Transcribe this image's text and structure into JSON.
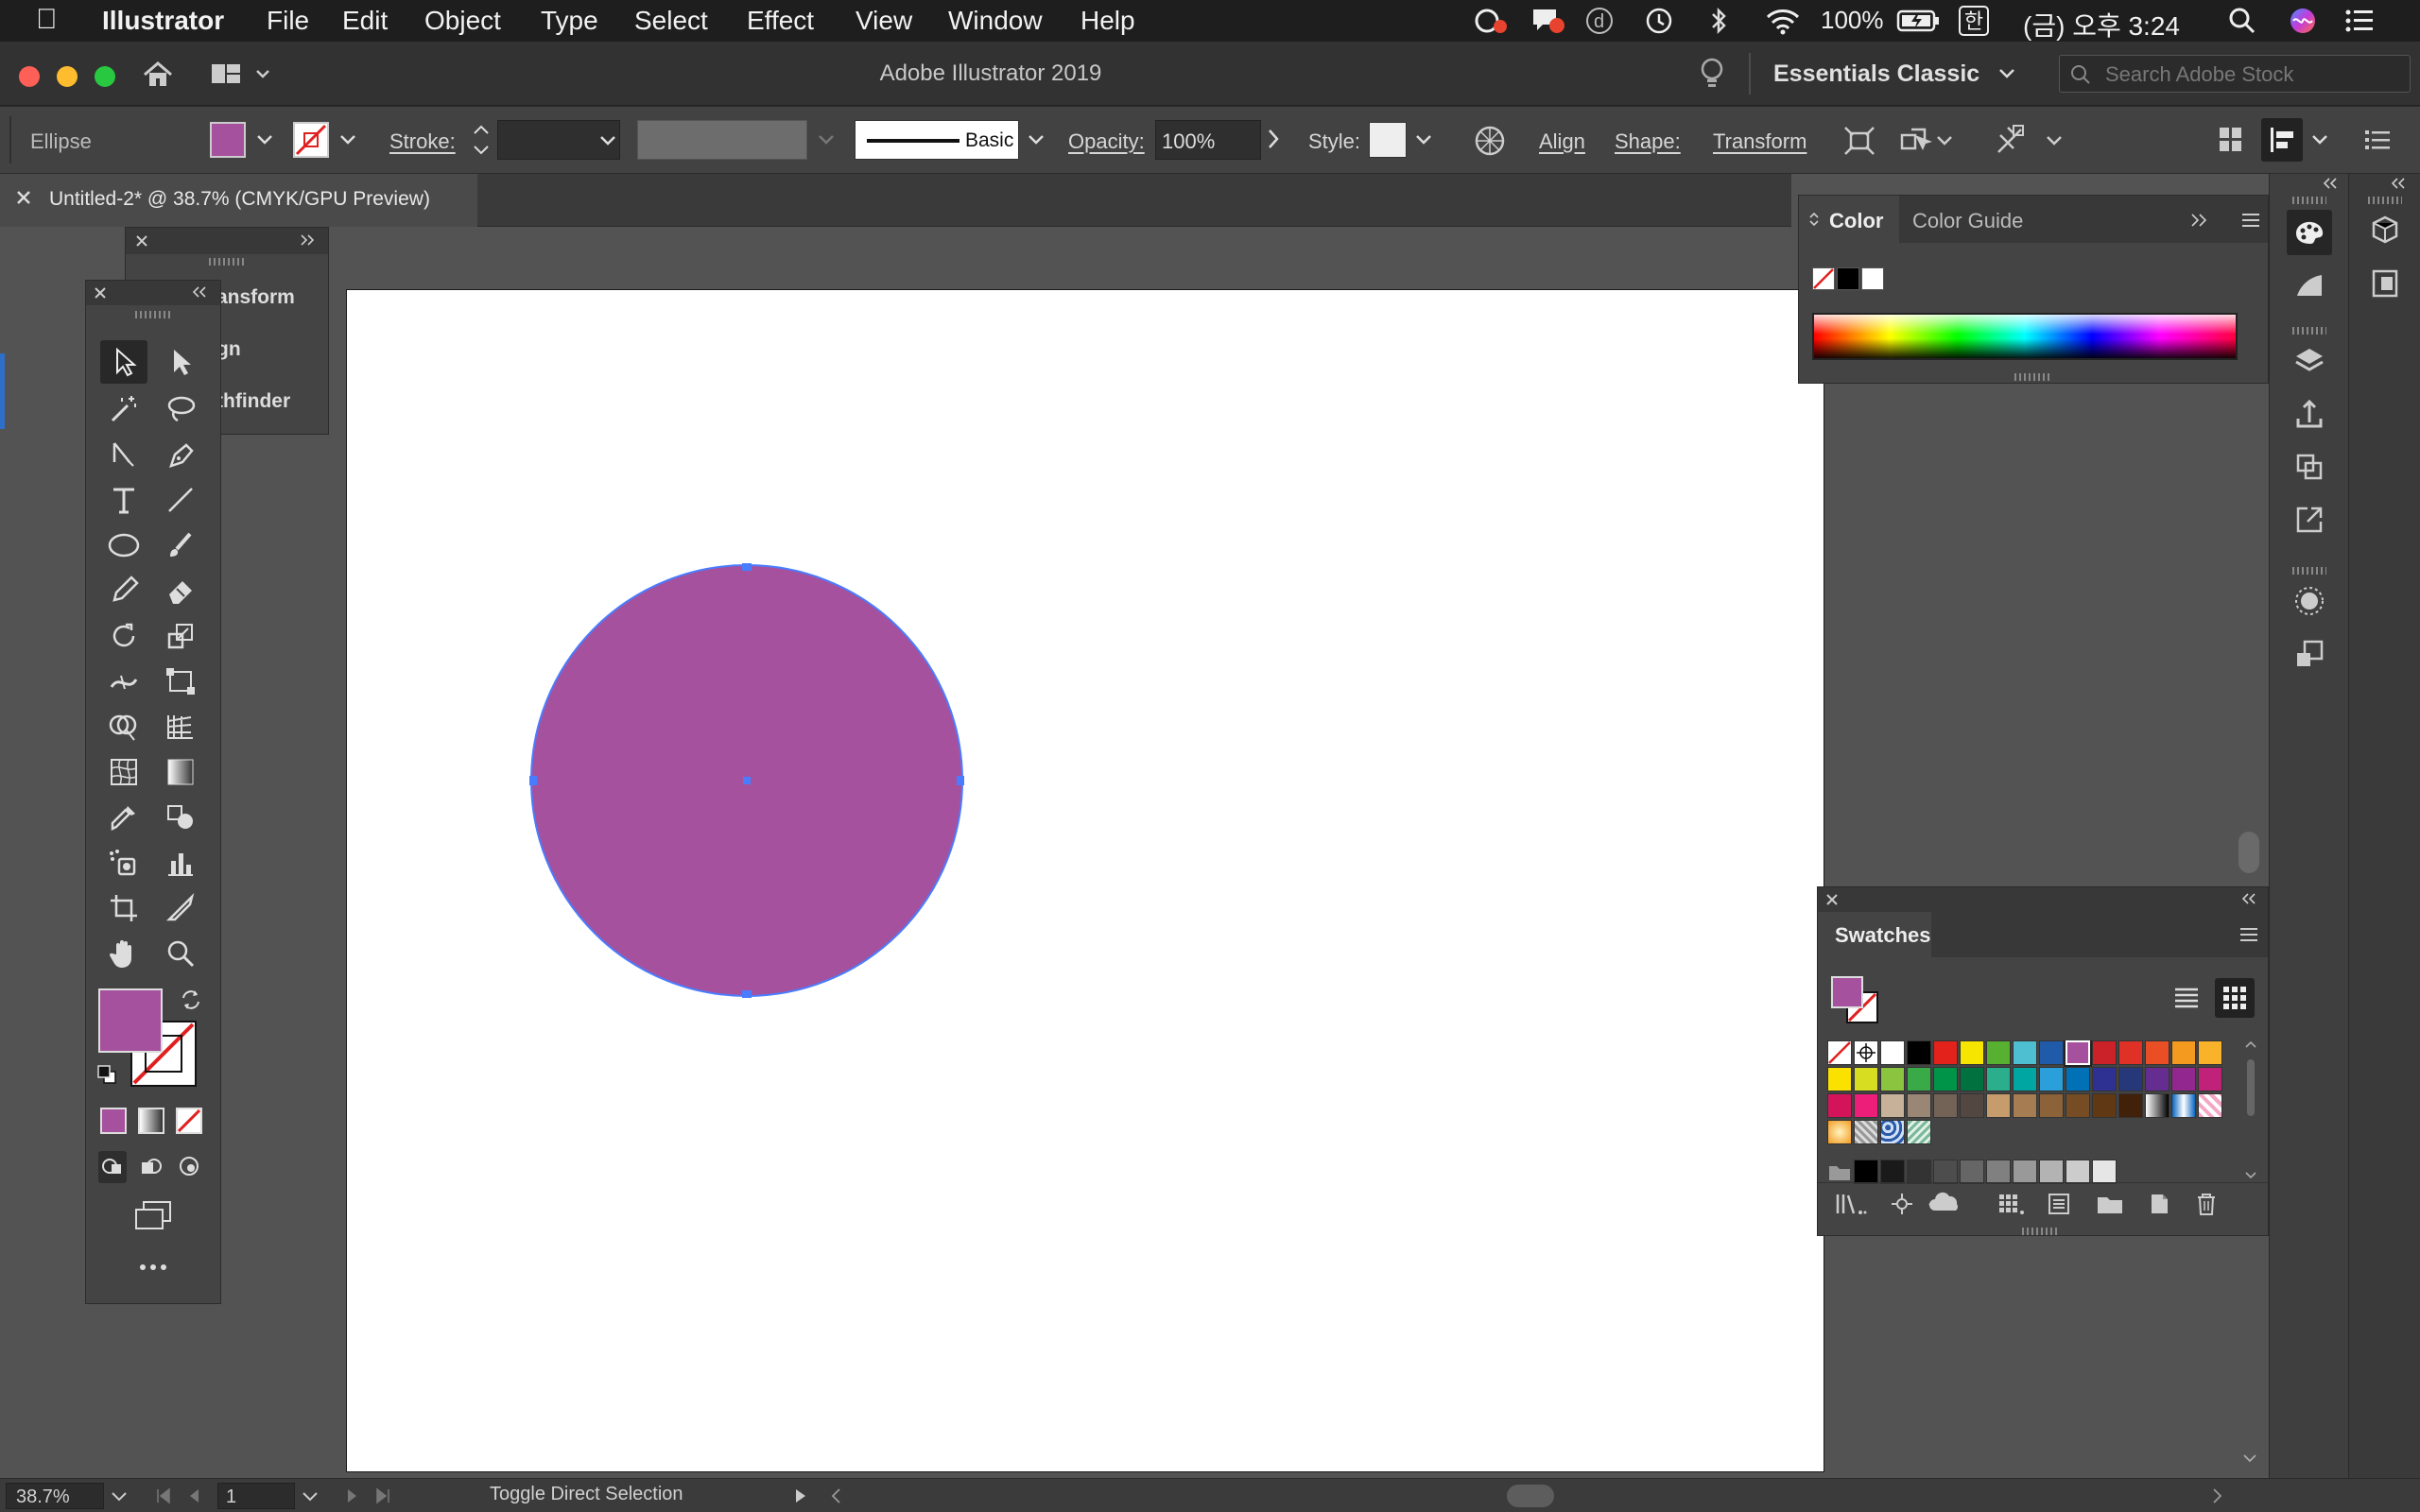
{
  "menubar": {
    "app": "Illustrator",
    "items": [
      "File",
      "Edit",
      "Object",
      "Type",
      "Select",
      "Effect",
      "View",
      "Window",
      "Help"
    ],
    "battery": "100%",
    "input_source": "한",
    "clock": "(금) 오후 3:24"
  },
  "titlebar": {
    "title": "Adobe Illustrator 2019",
    "workspace": "Essentials Classic",
    "search_placeholder": "Search Adobe Stock"
  },
  "control": {
    "selection_type": "Ellipse",
    "fill_color": "#a5519d",
    "stroke_label": "Stroke:",
    "brush": "Basic",
    "opacity_label": "Opacity:",
    "opacity_value": "100%",
    "style_label": "Style:",
    "align": "Align",
    "shape": "Shape:",
    "transform": "Transform"
  },
  "document": {
    "tab_title": "Untitled-2* @ 38.7% (CMYK/GPU Preview)",
    "shape_fill": "#a5519d",
    "selection_color": "#4a7cff"
  },
  "floating_panel": {
    "items": [
      "ansform",
      "gn",
      "thfinder"
    ]
  },
  "color_panel": {
    "tabs": [
      "Color",
      "Color Guide"
    ]
  },
  "swatches_panel": {
    "title": "Swatches",
    "rows": [
      [
        "none",
        "reg",
        "#ffffff",
        "#000000",
        "#e3221b",
        "#f6e500",
        "#58b031",
        "#4dbfd1",
        "#1f5ba8",
        "#a5519d",
        "#cb2128",
        "#e03127",
        "#e94e24",
        "#f39a1f",
        "#f8b32b"
      ],
      [
        "#fbe100",
        "#d7de21",
        "#8bc53f",
        "#3aaa49",
        "#009449",
        "#00713f",
        "#2aae8c",
        "#00a6a1",
        "#2a9fd9",
        "#0071b7",
        "#2e3192",
        "#263879",
        "#662d91",
        "#92278f",
        "#c12279"
      ],
      [
        "#d4145a",
        "#ed1e79",
        "#c7b299",
        "#998675",
        "#736357",
        "#534741",
        "#c69c6d",
        "#a67c52",
        "#8c6239",
        "#754c24",
        "#603813",
        "#42210b",
        "grad-bw",
        "grad-blue",
        "pattern-pink"
      ],
      [
        "grad-orange",
        "pattern-gray",
        "pattern-blue",
        "pattern-green"
      ],
      [
        "folder",
        "#000000",
        "#1a1a1a",
        "#333333",
        "#4d4d4d",
        "#666666",
        "#808080",
        "#999999",
        "#b3b3b3",
        "#cccccc",
        "#e6e6e6"
      ]
    ]
  },
  "status": {
    "zoom": "38.7%",
    "artboard": "1",
    "message": "Toggle Direct Selection"
  }
}
